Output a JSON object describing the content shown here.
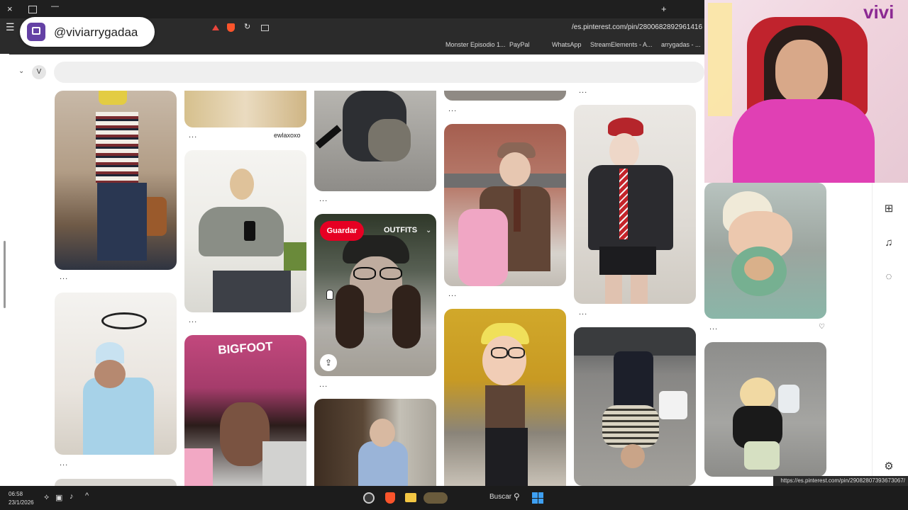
{
  "stream_overlay": {
    "twitch_handle": "@viviarrygadaa",
    "webcam_sign_text": "vivi"
  },
  "browser": {
    "address": "es.pinterest.com/pin/2800682892961416/",
    "bookmarks": [
      "arrygadas - ...",
      "StreamElements - A...",
      "WhatsApp",
      "PayPal",
      "Monster Episodio 1..."
    ],
    "tab_close_label": "×",
    "new_tab_label": "+"
  },
  "pinterest": {
    "avatar_letter": "V",
    "search_placeholder": "",
    "pin_more_label": "...",
    "caption_ewlaxoxo": "ewlaxoxo",
    "hover_pin": {
      "save_label": "Guardar",
      "board_label": "OUTFITS"
    },
    "hover_pin_2_label": "BIGFOOT",
    "heart": "♡"
  },
  "status_url": "https://es.pinterest.com/pin/29082807393673067/",
  "taskbar": {
    "search_label": "Buscar",
    "time": "06:58",
    "date": "23/1/2026"
  },
  "colors": {
    "pinterest_red": "#e60023",
    "twitch_purple": "#6441a5"
  }
}
